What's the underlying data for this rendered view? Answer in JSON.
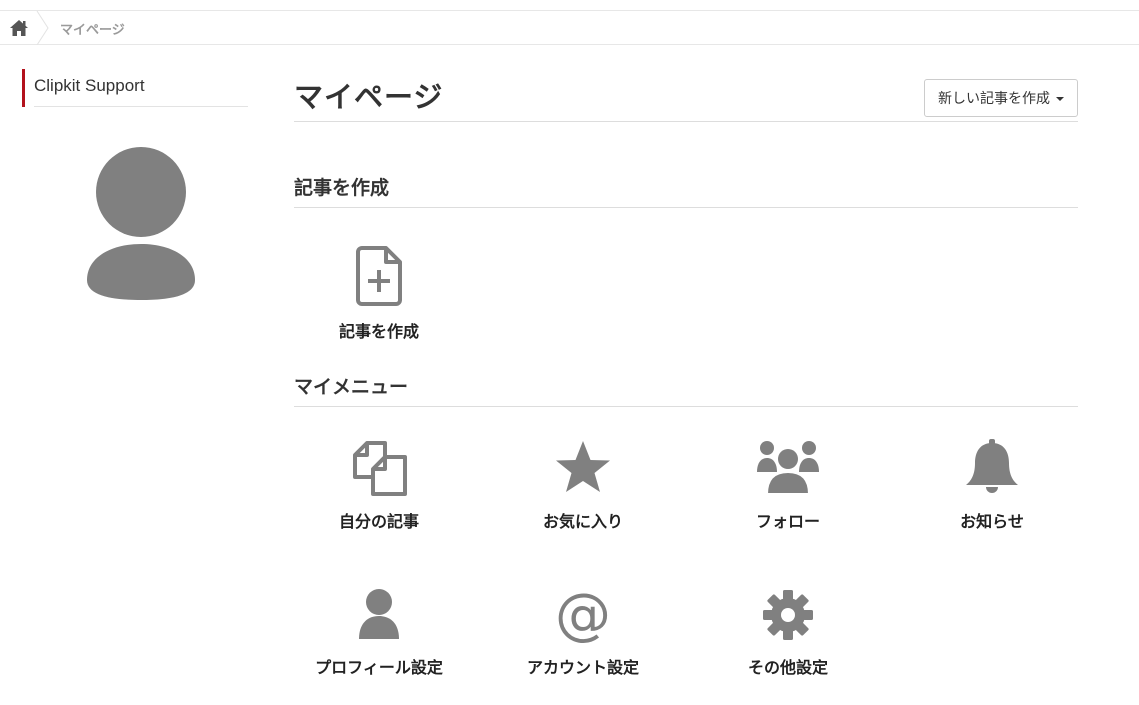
{
  "breadcrumb": {
    "home_icon": "home-icon",
    "current": "マイページ"
  },
  "sidebar": {
    "site_name": "Clipkit Support"
  },
  "header": {
    "title": "マイページ",
    "new_button_label": "新しい記事を作成"
  },
  "sections": {
    "create": {
      "title": "記事を作成",
      "items": [
        {
          "label": "記事を作成",
          "icon": "file-plus-icon"
        }
      ]
    },
    "menu": {
      "title": "マイメニュー",
      "items": [
        {
          "label": "自分の記事",
          "icon": "copy-icon"
        },
        {
          "label": "お気に入り",
          "icon": "star-icon"
        },
        {
          "label": "フォロー",
          "icon": "users-icon"
        },
        {
          "label": "お知らせ",
          "icon": "bell-icon"
        },
        {
          "label": "プロフィール設定",
          "icon": "user-icon"
        },
        {
          "label": "アカウント設定",
          "icon": "at-icon"
        },
        {
          "label": "その他設定",
          "icon": "gear-icon"
        }
      ]
    }
  },
  "colors": {
    "accent": "#b3121c",
    "icon": "#808080",
    "text": "#333333"
  }
}
